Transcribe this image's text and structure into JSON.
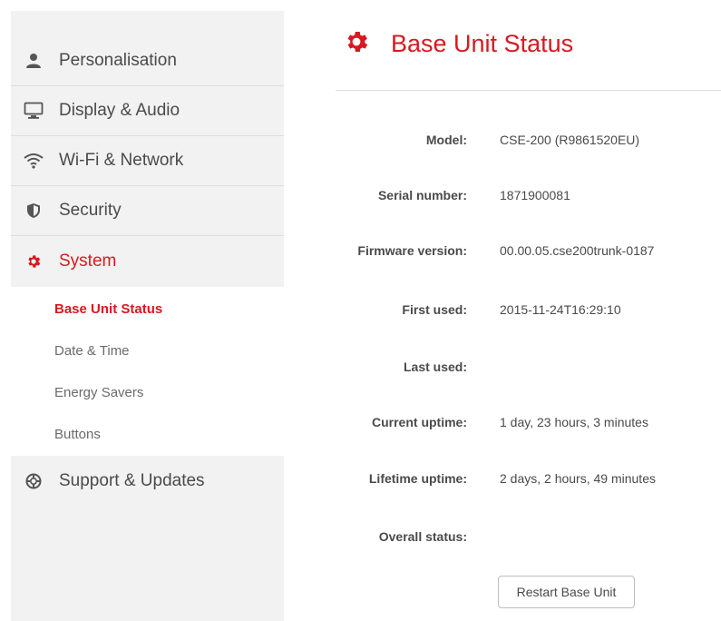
{
  "sidebar": {
    "items": [
      {
        "label": "Personalisation",
        "icon": "person-icon"
      },
      {
        "label": "Display & Audio",
        "icon": "monitor-icon"
      },
      {
        "label": "Wi-Fi & Network",
        "icon": "wifi-icon"
      },
      {
        "label": "Security",
        "icon": "shield-icon"
      },
      {
        "label": "System",
        "icon": "gear-icon",
        "active": true
      },
      {
        "label": "Support & Updates",
        "icon": "lifebuoy-icon"
      }
    ],
    "subitems": [
      {
        "label": "Base Unit Status",
        "active": true
      },
      {
        "label": "Date & Time"
      },
      {
        "label": "Energy Savers"
      },
      {
        "label": "Buttons"
      }
    ]
  },
  "header": {
    "title": "Base Unit Status",
    "icon": "gear-icon"
  },
  "status": {
    "rows": [
      {
        "key": "Model:",
        "value": "CSE-200 (R9861520EU)"
      },
      {
        "key": "Serial number:",
        "value": "1871900081"
      },
      {
        "key": "Firmware version:",
        "value": "00.00.05.cse200trunk-0187"
      },
      {
        "key": "First used:",
        "value": "2015-11-24T16:29:10"
      },
      {
        "key": "Last used:",
        "value": ""
      },
      {
        "key": "Current uptime:",
        "value": "1 day, 23 hours, 3 minutes"
      },
      {
        "key": "Lifetime uptime:",
        "value": "2 days, 2 hours, 49 minutes"
      },
      {
        "key": "Overall status:",
        "value": ""
      }
    ]
  },
  "actions": {
    "restart_label": "Restart Base Unit"
  },
  "colors": {
    "accent": "#d71920",
    "sidebar_bg": "#f2f2f2",
    "text": "#4a4a4a"
  }
}
